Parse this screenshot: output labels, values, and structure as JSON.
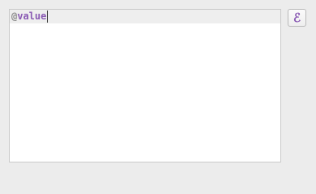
{
  "editor": {
    "at_symbol": "@",
    "value_word": "value"
  },
  "expression_button": {
    "icon": "expression-epsilon-icon",
    "glyph": "ℰ"
  },
  "colors": {
    "keyword": "#8a5ab4",
    "at_symbol": "#8c8c8c",
    "current_line": "#eeeeee",
    "window_background": "#ececec"
  }
}
